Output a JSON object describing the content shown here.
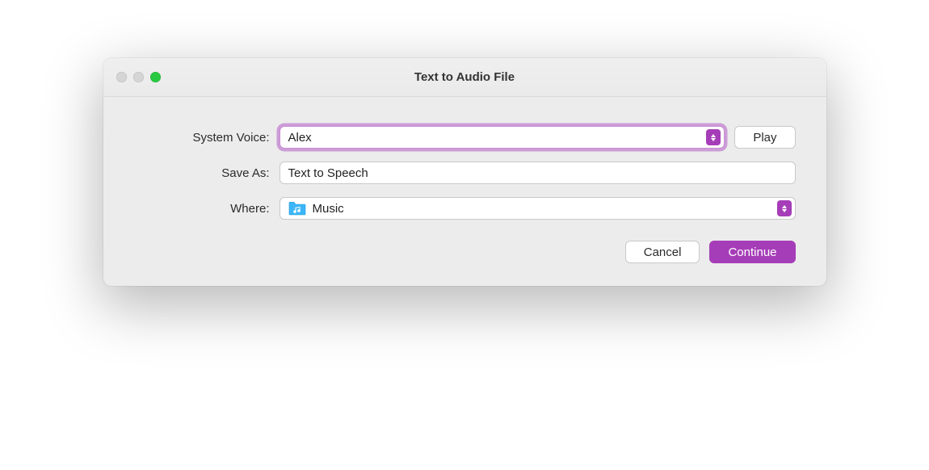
{
  "window": {
    "title": "Text to Audio File"
  },
  "form": {
    "system_voice_label": "System Voice:",
    "system_voice_value": "Alex",
    "play_button": "Play",
    "save_as_label": "Save As:",
    "save_as_value": "Text to Speech",
    "where_label": "Where:",
    "where_value": "Music"
  },
  "buttons": {
    "cancel": "Cancel",
    "continue": "Continue"
  },
  "colors": {
    "accent": "#a63db8",
    "window_bg": "#ececec",
    "folder_blue": "#3cb6f7"
  }
}
